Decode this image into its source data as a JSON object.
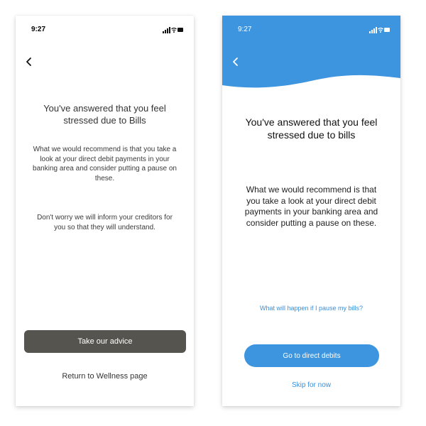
{
  "left": {
    "time": "9:27",
    "title": "You've answered that you feel stressed due to Bills",
    "para1": "What we would recommend is that you take a look at your direct debit payments in your banking area and consider putting a pause on these.",
    "para2": "Don't worry we will inform your creditors for you so that they will understand.",
    "primary_button": "Take our advice",
    "secondary_link": "Return to Wellness page"
  },
  "right": {
    "time": "9:27",
    "title": "You've answered that you feel stressed due to bills",
    "para": "What we would recommend is that you take a look at your direct debit payments in your banking area and consider putting a pause on these.",
    "question_link": "What will happen if I pause my bills?",
    "primary_button": "Go to direct debits",
    "skip_link": "Skip for now"
  },
  "colors": {
    "header_blue": "#3d95df",
    "link_blue": "#3a8fd9",
    "dark_button": "#55544e"
  },
  "icons": [
    "back-chevron-icon",
    "signal-icon",
    "wifi-icon",
    "battery-icon"
  ]
}
